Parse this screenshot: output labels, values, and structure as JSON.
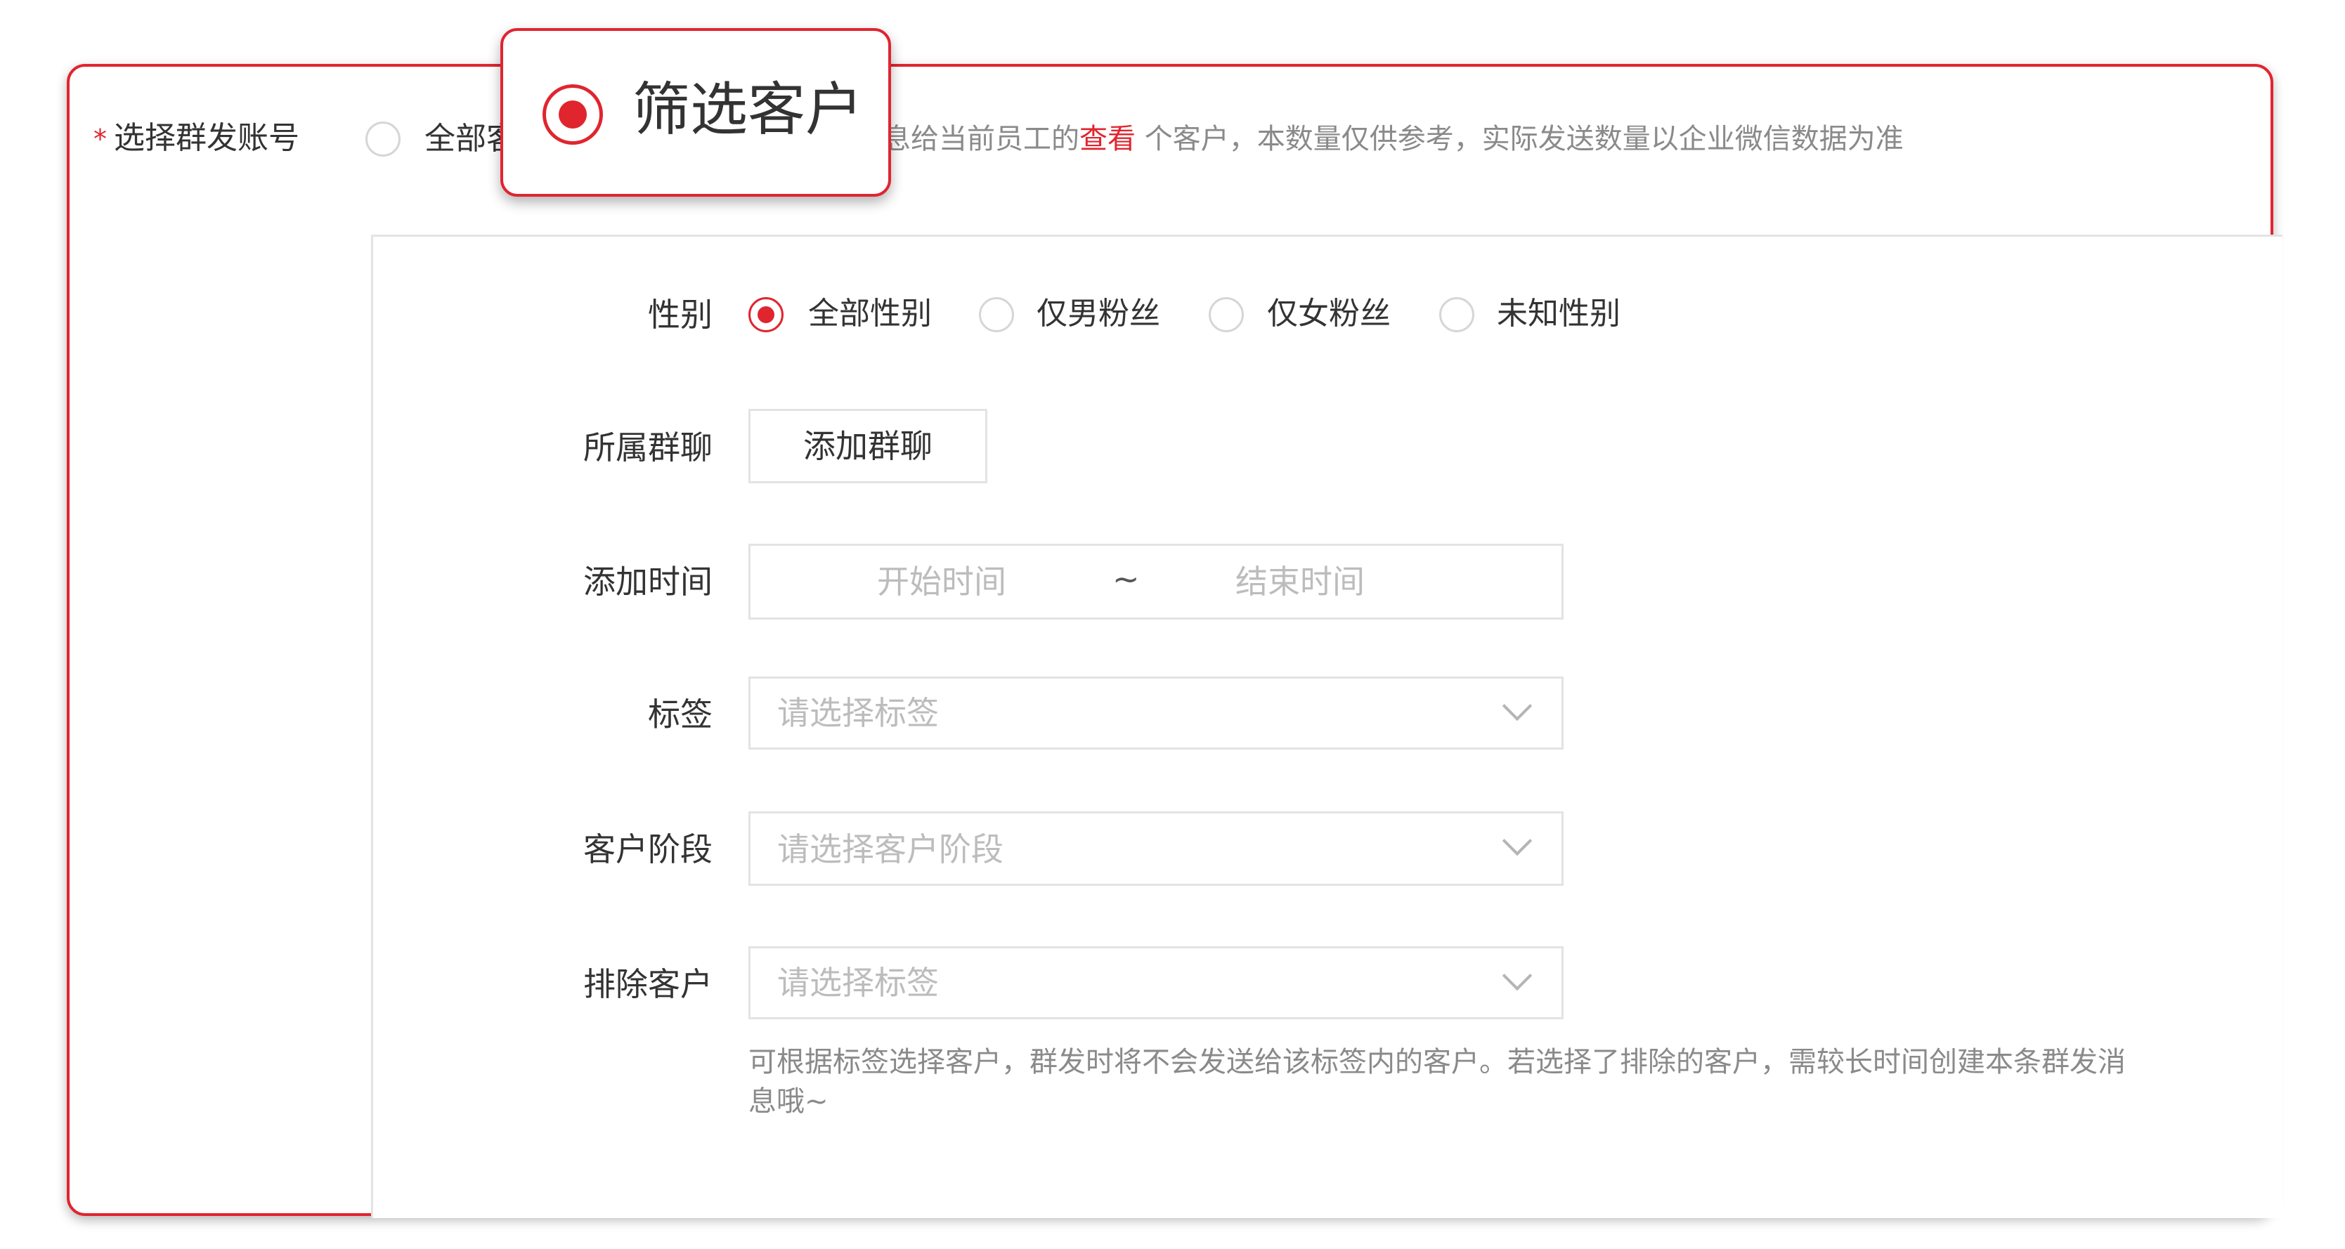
{
  "account_row": {
    "required_mark": "*",
    "label": "选择群发账号",
    "option_all": "全部客",
    "hint_pre": "发消息给当前员工的",
    "hint_link": "查看",
    "hint_post": " 个客户，本数量仅供参考，实际发送数量以企业微信数据为准"
  },
  "callout": {
    "label": "筛选客户",
    "selected": true
  },
  "filters": {
    "gender": {
      "label": "性别",
      "options": [
        "全部性别",
        "仅男粉丝",
        "仅女粉丝",
        "未知性别"
      ],
      "selected": "全部性别"
    },
    "group_chat": {
      "label": "所属群聊",
      "button": "添加群聊"
    },
    "add_time": {
      "label": "添加时间",
      "start_placeholder": "开始时间",
      "separator": "~",
      "end_placeholder": "结束时间"
    },
    "tags": {
      "label": "标签",
      "placeholder": "请选择标签"
    },
    "stage": {
      "label": "客户阶段",
      "placeholder": "请选择客户阶段"
    },
    "exclude": {
      "label": "排除客户",
      "placeholder": "请选择标签",
      "help": "可根据标签选择客户，群发时将不会发送给该标签内的客户。若选择了排除的客户，需较长时间创建本条群发消息哦~"
    }
  },
  "colors": {
    "accent": "#e0252f",
    "border": "#e3e3e3",
    "placeholder": "#bcbcbc",
    "hint": "#8a8a8a"
  }
}
